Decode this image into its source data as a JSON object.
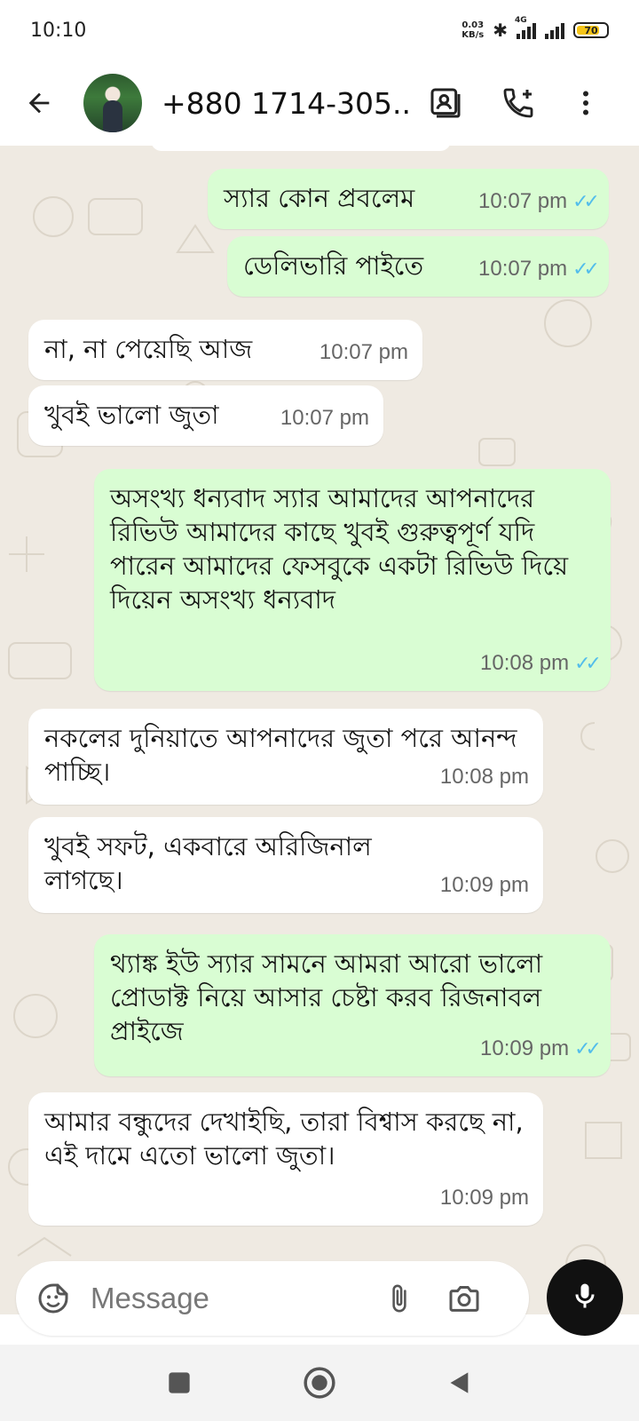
{
  "status_bar": {
    "time": "10:10",
    "net_speed_value": "0.03",
    "net_speed_unit": "KB/s",
    "network_type": "4G",
    "battery": "70"
  },
  "header": {
    "contact_name": "+880 1714-305...",
    "icons": [
      "back-arrow-icon",
      "contact-card-icon",
      "add-call-icon",
      "more-vert-icon"
    ]
  },
  "messages": [
    {
      "direction": "out",
      "text": "স্যার কোন প্রবলেম",
      "time": "10:07 pm",
      "status": "read"
    },
    {
      "direction": "out",
      "text": "ডেলিভারি পাইতে",
      "time": "10:07 pm",
      "status": "read"
    },
    {
      "direction": "in",
      "text": "না, না পেয়েছি আজ",
      "time": "10:07 pm"
    },
    {
      "direction": "in",
      "text": "খুবই ভালো জুতা",
      "time": "10:07 pm"
    },
    {
      "direction": "out",
      "text": "অসংখ্য ধন্যবাদ স্যার আমাদের আপনাদের রিভিউ আমাদের কাছে খুবই গুরুত্বপূর্ণ যদি পারেন আমাদের ফেসবুকে একটা রিভিউ দিয়ে দিয়েন অসংখ্য ধন্যবাদ",
      "time": "10:08 pm",
      "status": "read"
    },
    {
      "direction": "in",
      "text": "নকলের দুনিয়াতে আপনাদের জুতা পরে আনন্দ পাচ্ছি।",
      "time": "10:08 pm"
    },
    {
      "direction": "in",
      "text": "খুবই সফট, একবারে অরিজিনাল লাগছে।",
      "time": "10:09 pm"
    },
    {
      "direction": "out",
      "text": "থ্যাঙ্ক ইউ স্যার সামনে আমরা আরো ভালো প্রোডাক্ট নিয়ে আসার চেষ্টা করব রিজনাবল প্রাইজে",
      "time": "10:09 pm",
      "status": "read"
    },
    {
      "direction": "in",
      "text": "আমার বন্ধুদের দেখাইছি, তারা বিশ্বাস করছে না, এই দামে এতো ভালো জুতা।",
      "time": "10:09 pm"
    }
  ],
  "composer": {
    "placeholder": "Message"
  },
  "colors": {
    "outgoing_bubble": "#d9fdd3",
    "incoming_bubble": "#ffffff",
    "chat_background": "#efeae2",
    "read_ticks": "#53bdeb"
  }
}
